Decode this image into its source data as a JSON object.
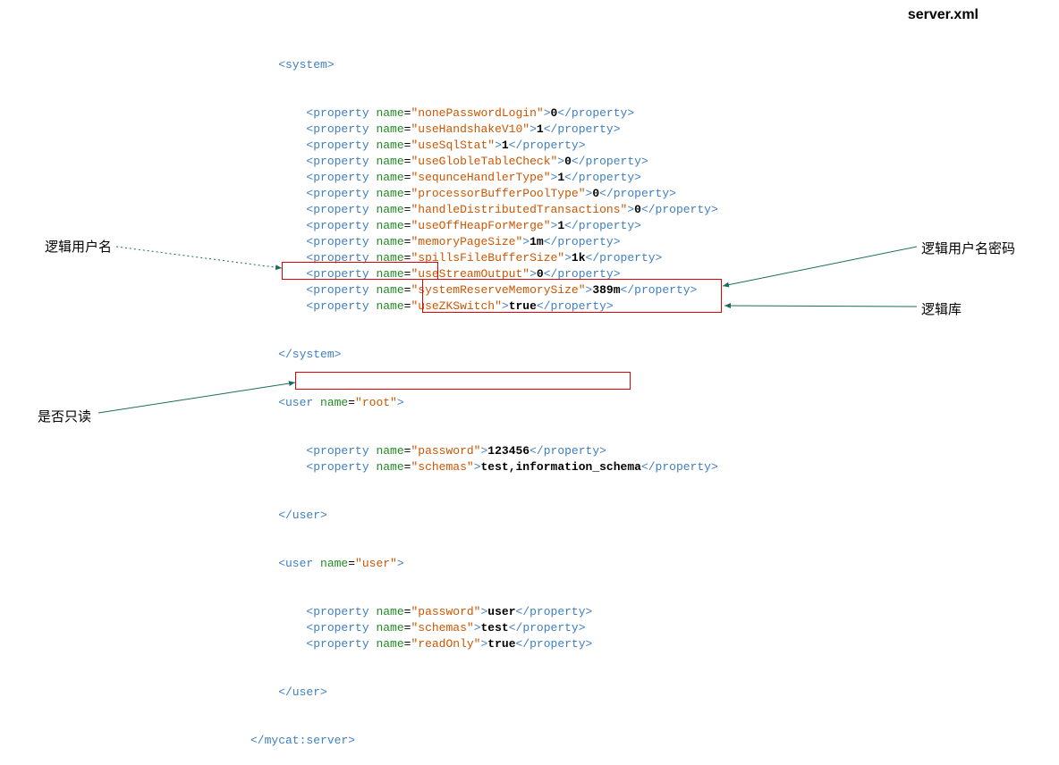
{
  "title": "server.xml",
  "annotations": {
    "logicalUsername": "逻辑用户名",
    "logicalUsernamePassword": "逻辑用户名密码",
    "logicalDatabase": "逻辑库",
    "readOnly": "是否只读"
  },
  "xml": {
    "root_open": "<system>",
    "root_close": "</system>",
    "mycat_close": "</mycat:server>",
    "system_properties": [
      {
        "name": "nonePasswordLogin",
        "value": "0"
      },
      {
        "name": "useHandshakeV10",
        "value": "1"
      },
      {
        "name": "useSqlStat",
        "value": "1"
      },
      {
        "name": "useGlobleTableCheck",
        "value": "0"
      },
      {
        "name": "sequnceHandlerType",
        "value": "1"
      },
      {
        "name": "processorBufferPoolType",
        "value": "0"
      },
      {
        "name": "handleDistributedTransactions",
        "value": "0"
      },
      {
        "name": "useOffHeapForMerge",
        "value": "1"
      },
      {
        "name": "memoryPageSize",
        "value": "1m"
      },
      {
        "name": "spillsFileBufferSize",
        "value": "1k"
      },
      {
        "name": "useStreamOutput",
        "value": "0"
      },
      {
        "name": "systemReserveMemorySize",
        "value": "389m"
      },
      {
        "name": "useZKSwitch",
        "value": "true"
      }
    ],
    "user_root": {
      "name": "root",
      "open": "<user name=\"root\">",
      "close": "</user>",
      "props": [
        {
          "name": "password",
          "value": "123456"
        },
        {
          "name": "schemas",
          "value": "test,information_schema"
        }
      ]
    },
    "user_user": {
      "name": "user",
      "open": "<user name=\"user\">",
      "close": "</user>",
      "props": [
        {
          "name": "password",
          "value": "user"
        },
        {
          "name": "schemas",
          "value": "test"
        },
        {
          "name": "readOnly",
          "value": "true"
        }
      ]
    }
  }
}
